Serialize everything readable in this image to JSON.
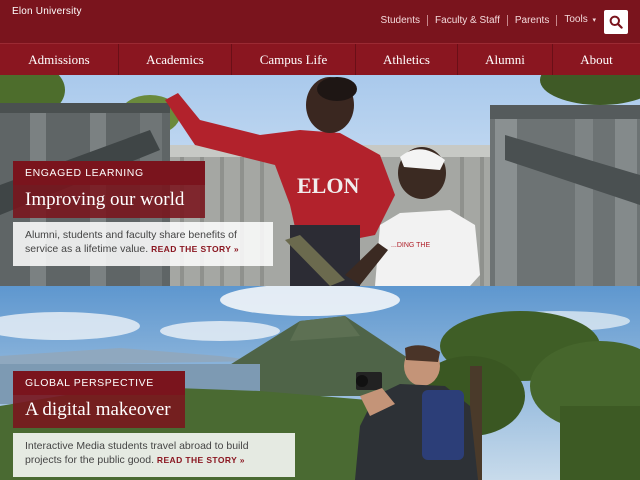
{
  "header": {
    "brand": "Elon University",
    "utility_links": [
      "Students",
      "Faculty & Staff",
      "Parents",
      "Tools"
    ],
    "tools_chevron": "›"
  },
  "nav": {
    "items": [
      "Admissions",
      "Academics",
      "Campus Life",
      "Athletics",
      "Alumni",
      "About"
    ]
  },
  "stories": [
    {
      "eyebrow": "ENGAGED LEARNING",
      "headline": "Improving our world",
      "description": "Alumni, students and faculty share benefits of service as a lifetime value.",
      "cta": "READ THE STORY »",
      "shirt_text": "ELON",
      "shirt_text_2": "...DING THE"
    },
    {
      "eyebrow": "GLOBAL PERSPECTIVE",
      "headline": "A digital makeover",
      "description": "Interactive Media students travel abroad to build projects for the public good.",
      "cta": "READ THE STORY »"
    }
  ],
  "colors": {
    "brand_maroon": "#7a141d",
    "nav_maroon": "#8a1620",
    "cta_red": "#8a1620"
  }
}
